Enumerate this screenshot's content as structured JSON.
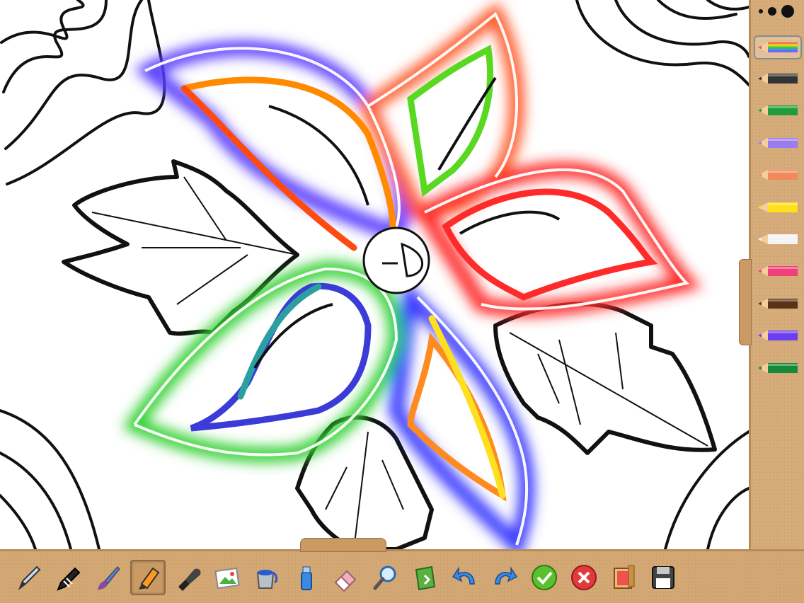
{
  "app": {
    "canvas_bg": "#ffffff",
    "panel_color": "#d7ac7b"
  },
  "brush_size": {
    "options": [
      "small",
      "medium",
      "large"
    ],
    "selected": "large"
  },
  "pencils": [
    {
      "name": "rainbow",
      "color": "rainbow",
      "selected": true
    },
    {
      "name": "black",
      "color": "#333333"
    },
    {
      "name": "green",
      "color": "#1e9e3a"
    },
    {
      "name": "lavender",
      "color": "#9a7cf0"
    },
    {
      "name": "salmon",
      "color": "#f08a5d"
    },
    {
      "name": "yellow",
      "color": "#ffe01a"
    },
    {
      "name": "white",
      "color": "#f4f4f4"
    },
    {
      "name": "pink",
      "color": "#f0407a"
    },
    {
      "name": "brown",
      "color": "#5a3218"
    },
    {
      "name": "violet",
      "color": "#6a3df0"
    },
    {
      "name": "dark-green",
      "color": "#178a3a"
    }
  ],
  "toolbar": {
    "tools": [
      {
        "name": "pencil-tool",
        "icon": "pencil-icon"
      },
      {
        "name": "crayon-tool",
        "icon": "crayon-icon"
      },
      {
        "name": "paintbrush-tool",
        "icon": "paintbrush-icon"
      },
      {
        "name": "marker-tool",
        "icon": "marker-icon",
        "active": true
      },
      {
        "name": "stamp-tool",
        "icon": "stamp-icon"
      },
      {
        "name": "image-tool",
        "icon": "picture-icon"
      },
      {
        "name": "paint-bucket-tool",
        "icon": "paint-bucket-icon"
      },
      {
        "name": "spray-tool",
        "icon": "spray-icon"
      },
      {
        "name": "eraser-tool",
        "icon": "eraser-icon"
      },
      {
        "name": "zoom-tool",
        "icon": "magnifier-icon"
      },
      {
        "name": "clear-tool",
        "icon": "recycle-icon"
      },
      {
        "name": "undo-button",
        "icon": "undo-icon"
      },
      {
        "name": "redo-button",
        "icon": "redo-icon"
      },
      {
        "name": "confirm-button",
        "icon": "check-icon"
      },
      {
        "name": "cancel-button",
        "icon": "close-icon"
      },
      {
        "name": "gallery-button",
        "icon": "gallery-icon"
      },
      {
        "name": "save-button",
        "icon": "floppy-icon"
      }
    ]
  }
}
